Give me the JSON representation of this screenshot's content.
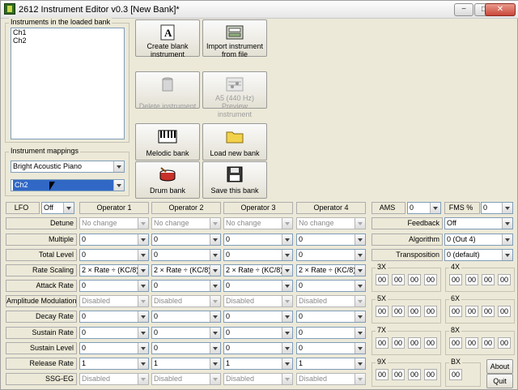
{
  "window": {
    "title": "2612 Instrument Editor v0.3 [New Bank]*"
  },
  "titlebar": {
    "minimize": "−",
    "maximize": "□",
    "close": "✕"
  },
  "instruments": {
    "group_label": "Instruments in the loaded bank",
    "items": [
      "Ch1",
      "Ch2"
    ]
  },
  "mappings": {
    "group_label": "Instrument mappings",
    "program": "Bright Acoustic Piano",
    "channel": "Ch2"
  },
  "buttons": {
    "create_blank": "Create blank instrument",
    "import_file": "Import instrument from file",
    "delete": "Delete instrument",
    "preview_top": "A5 (440 Hz)",
    "preview": "Preview instrument",
    "melodic": "Melodic bank",
    "load_new": "Load new bank",
    "drum": "Drum bank",
    "save_bank": "Save this bank",
    "about": "About",
    "quit": "Quit"
  },
  "lfo": {
    "label": "LFO",
    "value": "Off"
  },
  "operators": {
    "headers": [
      "Operator 1",
      "Operator 2",
      "Operator 3",
      "Operator 4"
    ]
  },
  "params": [
    {
      "label": "Detune",
      "values": [
        "No change",
        "No change",
        "No change",
        "No change"
      ],
      "disabled": true
    },
    {
      "label": "Multiple",
      "values": [
        "0",
        "0",
        "0",
        "0"
      ],
      "disabled": false
    },
    {
      "label": "Total Level",
      "values": [
        "0",
        "0",
        "0",
        "0"
      ],
      "disabled": false
    },
    {
      "label": "Rate Scaling",
      "values": [
        "2 × Rate ÷ (KC/8)",
        "2 × Rate ÷ (KC/8)",
        "2 × Rate ÷ (KC/8)",
        "2 × Rate ÷ (KC/8)"
      ],
      "disabled": false
    },
    {
      "label": "Attack Rate",
      "values": [
        "0",
        "0",
        "0",
        "0"
      ],
      "disabled": false
    },
    {
      "label": "Amplitude Modulation",
      "values": [
        "Disabled",
        "Disabled",
        "Disabled",
        "Disabled"
      ],
      "disabled": true
    },
    {
      "label": "Decay Rate",
      "values": [
        "0",
        "0",
        "0",
        "0"
      ],
      "disabled": false
    },
    {
      "label": "Sustain Rate",
      "values": [
        "0",
        "0",
        "0",
        "0"
      ],
      "disabled": false
    },
    {
      "label": "Sustain Level",
      "values": [
        "0",
        "0",
        "0",
        "0"
      ],
      "disabled": false
    },
    {
      "label": "Release Rate",
      "values": [
        "1",
        "1",
        "1",
        "1"
      ],
      "disabled": false
    },
    {
      "label": "SSG-EG",
      "values": [
        "Disabled",
        "Disabled",
        "Disabled",
        "Disabled"
      ],
      "disabled": true
    }
  ],
  "ams": {
    "label": "AMS",
    "value": "0"
  },
  "fms": {
    "label": "FMS %",
    "value": "0"
  },
  "right": {
    "feedback_label": "Feedback",
    "feedback_value": "Off",
    "algorithm_label": "Algorithm",
    "algorithm_value": "0 (Out 4)",
    "transposition_label": "Transposition",
    "transposition_value": "0 (default)"
  },
  "hex_groups": [
    {
      "label": "3X",
      "digits": [
        "00",
        "00",
        "00",
        "00"
      ]
    },
    {
      "label": "4X",
      "digits": [
        "00",
        "00",
        "00",
        "00"
      ]
    },
    {
      "label": "5X",
      "digits": [
        "00",
        "00",
        "00",
        "00"
      ]
    },
    {
      "label": "6X",
      "digits": [
        "00",
        "00",
        "00",
        "00"
      ]
    },
    {
      "label": "7X",
      "digits": [
        "00",
        "00",
        "00",
        "00"
      ]
    },
    {
      "label": "8X",
      "digits": [
        "00",
        "00",
        "00",
        "00"
      ]
    },
    {
      "label": "9X",
      "digits": [
        "00",
        "00",
        "00",
        "00"
      ]
    },
    {
      "label": "BX",
      "digits": [
        "00"
      ]
    }
  ]
}
